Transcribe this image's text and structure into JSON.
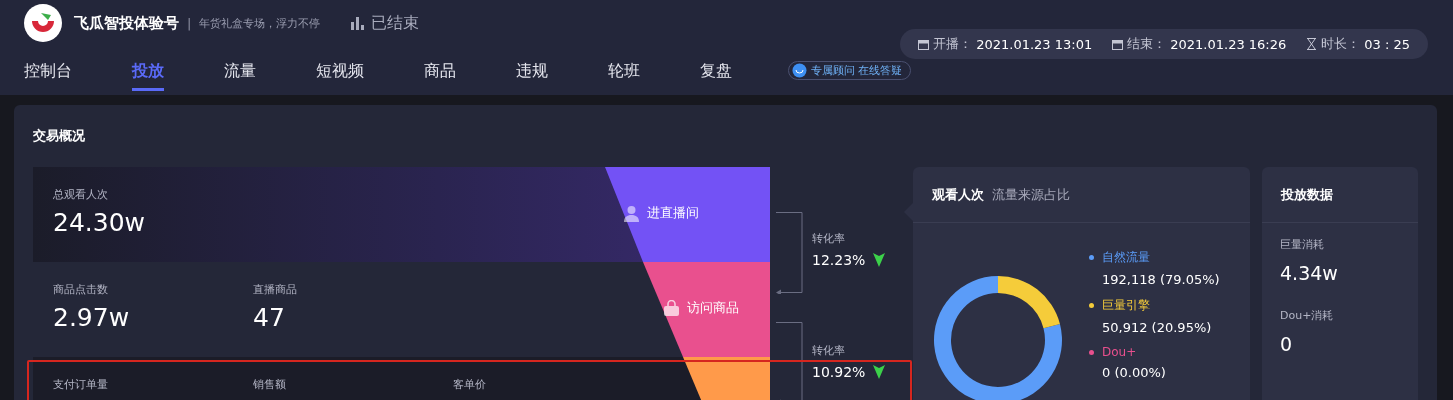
{
  "header": {
    "account": "飞瓜智投体验号",
    "separator": "|",
    "subtitle": "年货礼盒专场，浮力不停",
    "status": "已结束"
  },
  "times": [
    {
      "kind": "calendar",
      "label": "开播：",
      "value": "2021.01.23 13:01"
    },
    {
      "kind": "calendar",
      "label": "结束：",
      "value": "2021.01.23 16:26"
    },
    {
      "kind": "hourglass",
      "label": "时长：",
      "value": "03 : 25"
    }
  ],
  "tabs": [
    {
      "label": "控制台",
      "selected": false
    },
    {
      "label": "投放",
      "selected": true
    },
    {
      "label": "流量",
      "selected": false
    },
    {
      "label": "短视频",
      "selected": false
    },
    {
      "label": "商品",
      "selected": false
    },
    {
      "label": "违规",
      "selected": false
    },
    {
      "label": "轮班",
      "selected": false
    },
    {
      "label": "复盘",
      "selected": false
    }
  ],
  "advisor_badge": "专属顾问 在线答疑",
  "overview": {
    "title": "交易概况",
    "rows": [
      {
        "highlighted": false,
        "metrics": [
          {
            "label": "总观看人次",
            "value": "24.30w"
          }
        ],
        "stage": {
          "kind": "person",
          "label": "进直播间",
          "color": "#7352f5"
        }
      },
      {
        "highlighted": false,
        "metrics": [
          {
            "label": "商品点击数",
            "value": "2.97w"
          },
          {
            "label": "直播商品",
            "value": "47"
          }
        ],
        "stage": {
          "kind": "bag",
          "label": "访问商品",
          "color": "#e9508e"
        }
      },
      {
        "highlighted": true,
        "metrics": [
          {
            "label": "支付订单量"
          },
          {
            "label": "销售额"
          },
          {
            "label": "客单价"
          }
        ],
        "stage": {
          "color": "#ff9a4a"
        }
      }
    ],
    "rates": [
      {
        "label": "转化率",
        "value": "12.23%"
      },
      {
        "label": "转化率",
        "value": "10.92%"
      }
    ]
  },
  "traffic": {
    "subtitle": "流量来源占比",
    "legend": [
      {
        "value": "192,118  (79.05%)",
        "color": "#5b9cf8"
      },
      {
        "value": "50,912  (20.95%)",
        "color": "#f5cc3a"
      },
      {
        "value": "0  (0.00%)",
        "color": "#e9508e"
      }
    ],
    "chart_data": {
      "type": "donut",
      "categories": [
        "自然流量",
        "巨量引擎",
        "Dou+"
      ],
      "series": [
        {
          "name": "观看人次",
          "values": [
            79.05,
            20.95,
            0
          ]
        }
      ]
    }
  },
  "spend": {
    "title": "投放数据",
    "items": [
      {
        "label": "巨量消耗",
        "value": "4.34w"
      },
      {
        "label": "Dou+消耗",
        "value": "0"
      }
    ]
  }
}
